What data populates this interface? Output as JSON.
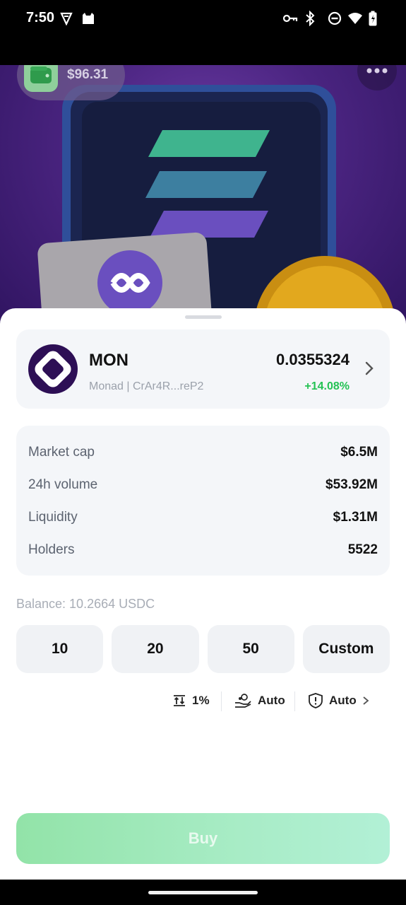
{
  "status_bar": {
    "time": "7:50",
    "icons": [
      "vpn-shield-icon",
      "cat-icon",
      "key-icon",
      "bluetooth-icon",
      "do-not-disturb-icon",
      "wifi-icon",
      "battery-icon"
    ]
  },
  "hero": {
    "wallet_balance": "$96.31",
    "wallet_icon": "wallet-icon",
    "more_icon": "more-dots-icon"
  },
  "token": {
    "symbol": "MON",
    "subtitle": "Monad | CrAr4R...reP2",
    "price": "0.0355324",
    "change": "+14.08%",
    "change_color": "#24c254"
  },
  "stats": [
    {
      "label": "Market cap",
      "value": "$6.5M"
    },
    {
      "label": "24h volume",
      "value": "$53.92M"
    },
    {
      "label": "Liquidity",
      "value": "$1.31M"
    },
    {
      "label": "Holders",
      "value": "5522"
    }
  ],
  "balance_text": "Balance: 10.2664 USDC",
  "amounts": [
    "10",
    "20",
    "50",
    "Custom"
  ],
  "settings": {
    "slippage": "1%",
    "fee": "Auto",
    "protection": "Auto"
  },
  "buy_label": "Buy",
  "colors": {
    "accent_green": "#24c254",
    "buy_gradient_start": "#92e3a8",
    "buy_gradient_end": "#b2f0d6"
  }
}
